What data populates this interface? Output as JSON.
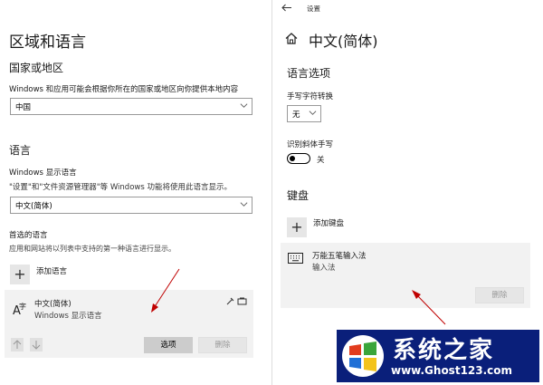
{
  "left": {
    "title": "区域和语言",
    "region_heading": "国家或地区",
    "region_desc": "Windows 和应用可能会根据你所在的国家或地区向你提供本地内容",
    "region_value": "中国",
    "language_heading": "语言",
    "display_lang_label": "Windows 显示语言",
    "display_lang_desc": "\"设置\"和\"文件资源管理器\"等 Windows 功能将使用此语言显示。",
    "display_lang_value": "中文(简体)",
    "preferred_heading": "首选的语言",
    "preferred_desc": "应用和网站将以列表中支持的第一种语言进行显示。",
    "add_language_label": "添加语言",
    "lang_item_name": "中文(简体)",
    "lang_item_sub": "Windows 显示语言",
    "options_button": "选项",
    "remove_button": "删除"
  },
  "right": {
    "window_title": "设置",
    "page_title": "中文(简体)",
    "lang_options_heading": "语言选项",
    "handwriting_label": "手写字符转换",
    "handwriting_value": "无",
    "italic_label": "识别斜体手写",
    "italic_toggle_state": "关",
    "keyboard_heading": "键盘",
    "add_keyboard_label": "添加键盘",
    "ime_name": "万能五笔输入法",
    "ime_sub": "输入法",
    "ime_remove_button": "删除"
  },
  "watermark": {
    "title": "系统之家",
    "url": "www.Ghost123.com"
  },
  "colors": {
    "accent_arrow": "#c00000",
    "watermark_bg": "#0a1f7a",
    "panel_bg": "#f2f2f2"
  }
}
